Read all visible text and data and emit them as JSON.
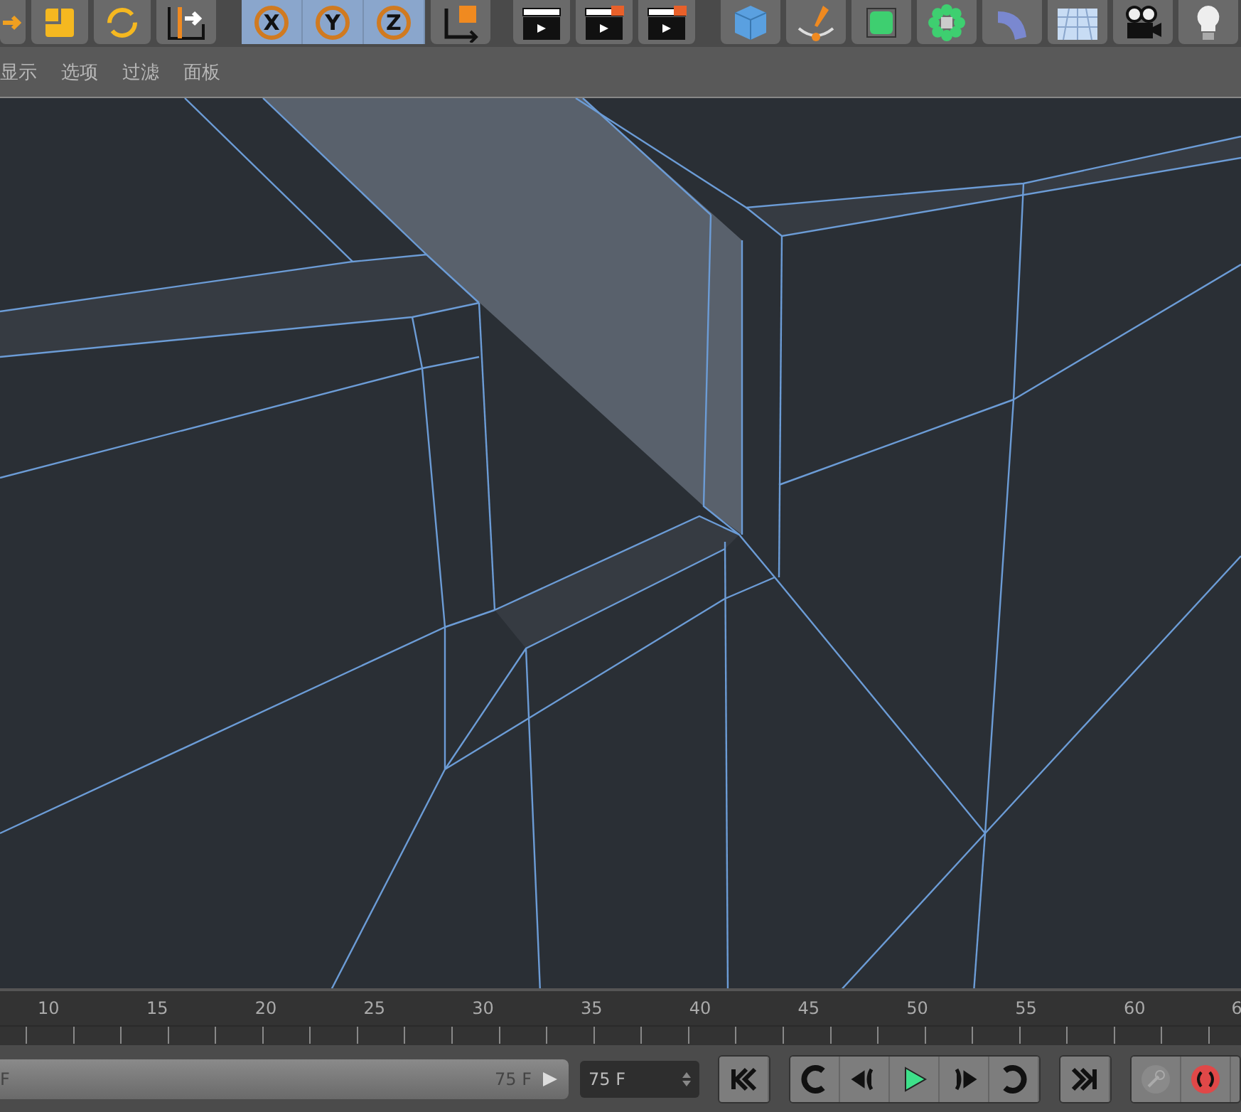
{
  "toolbar": {
    "axes": [
      {
        "label": "X",
        "selected": true
      },
      {
        "label": "Y",
        "selected": true
      },
      {
        "label": "Z",
        "selected": true
      }
    ]
  },
  "menu": [
    "显示",
    "选项",
    "过滤",
    "面板"
  ],
  "timeline": {
    "labels": [
      {
        "text": "10",
        "kind": "full"
      },
      {
        "text": "15",
        "kind": "full"
      },
      {
        "text": "20",
        "kind": "full"
      },
      {
        "text": "25",
        "kind": "full"
      },
      {
        "text": "30",
        "kind": "full"
      },
      {
        "text": "35",
        "kind": "full"
      },
      {
        "text": "40",
        "kind": "full"
      },
      {
        "text": "45",
        "kind": "full"
      },
      {
        "text": "50",
        "kind": "full"
      },
      {
        "text": "55",
        "kind": "full"
      },
      {
        "text": "60",
        "kind": "full"
      },
      {
        "text": "6",
        "kind": "partial"
      }
    ]
  },
  "range": {
    "start": "F",
    "end": "75 F",
    "level": 1
  },
  "frame_field": {
    "value": "75 F"
  }
}
